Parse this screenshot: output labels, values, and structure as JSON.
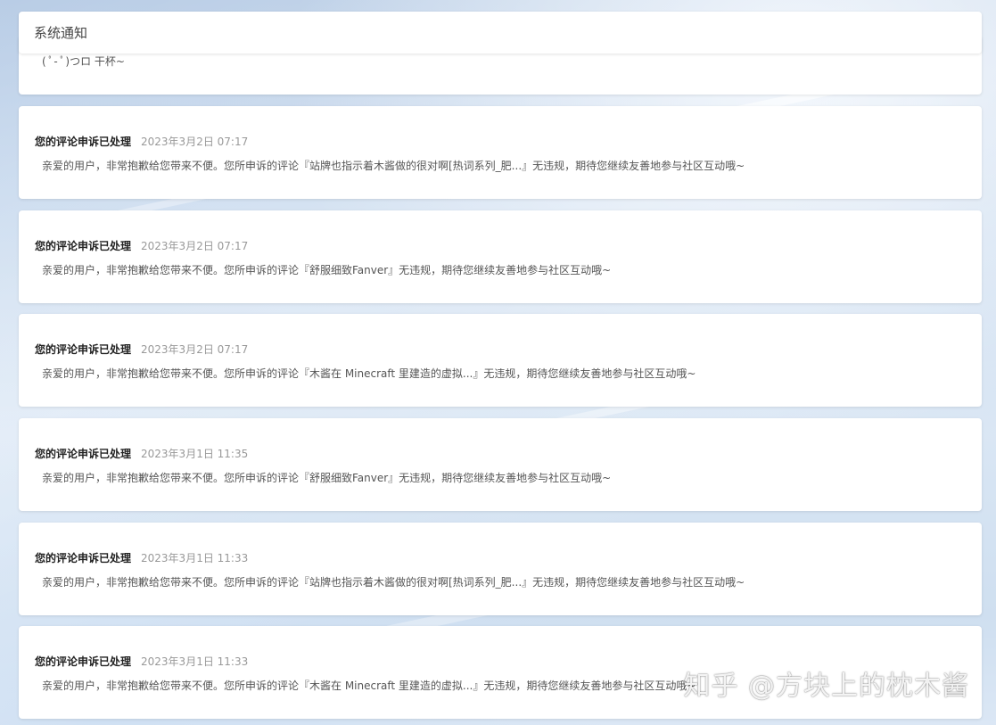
{
  "header": {
    "title": "系统通知"
  },
  "partial_notice": {
    "text": "( ﾟ- ﾟ)つロ 干杯~"
  },
  "notifications": [
    {
      "title": "您的评论申诉已处理",
      "time": "2023年3月2日 07:17",
      "body": "亲爱的用户，非常抱歉给您带来不便。您所申诉的评论『站牌也指示着木酱做的很对啊[热词系列_肥...』无违规，期待您继续友善地参与社区互动哦~"
    },
    {
      "title": "您的评论申诉已处理",
      "time": "2023年3月2日 07:17",
      "body": "亲爱的用户，非常抱歉给您带来不便。您所申诉的评论『舒服细致Fanver』无违规，期待您继续友善地参与社区互动哦~"
    },
    {
      "title": "您的评论申诉已处理",
      "time": "2023年3月2日 07:17",
      "body": "亲爱的用户，非常抱歉给您带来不便。您所申诉的评论『木酱在 Minecraft 里建造的虚拟...』无违规，期待您继续友善地参与社区互动哦~"
    },
    {
      "title": "您的评论申诉已处理",
      "time": "2023年3月1日 11:35",
      "body": "亲爱的用户，非常抱歉给您带来不便。您所申诉的评论『舒服细致Fanver』无违规，期待您继续友善地参与社区互动哦~"
    },
    {
      "title": "您的评论申诉已处理",
      "time": "2023年3月1日 11:33",
      "body": "亲爱的用户，非常抱歉给您带来不便。您所申诉的评论『站牌也指示着木酱做的很对啊[热词系列_肥...』无违规，期待您继续友善地参与社区互动哦~"
    },
    {
      "title": "您的评论申诉已处理",
      "time": "2023年3月1日 11:33",
      "body": "亲爱的用户，非常抱歉给您带来不便。您所申诉的评论『木酱在 Minecraft 里建造的虚拟...』无违规，期待您继续友善地参与社区互动哦~"
    }
  ],
  "watermark": {
    "text": "知乎 @方块上的枕木酱"
  }
}
